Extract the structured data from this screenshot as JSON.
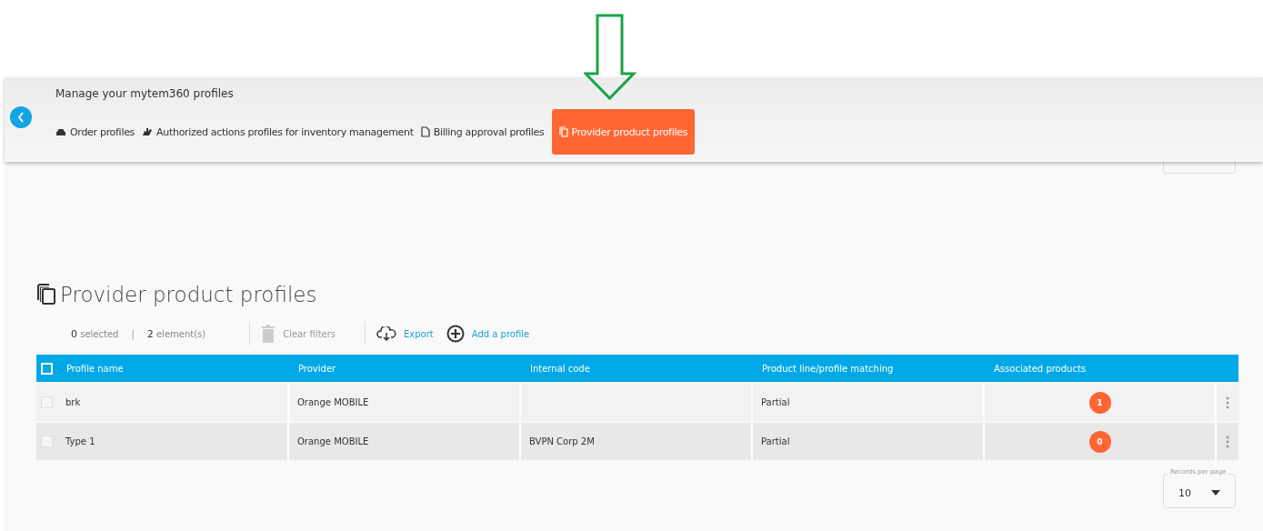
{
  "header": {
    "title": "Manage your mytem360 profiles",
    "tabs": [
      {
        "label": "Order profiles",
        "selected": false
      },
      {
        "label": "Authorized actions profiles for inventory management",
        "selected": false
      },
      {
        "label": "Billing approval profiles",
        "selected": false
      },
      {
        "label": "Provider product profiles",
        "selected": true
      }
    ]
  },
  "page_title": "Provider product profiles",
  "toolbar": {
    "selected_count": "0",
    "selected_label": "selected",
    "separator": "|",
    "element_count": "2",
    "element_label": "element(s)",
    "actions": [
      {
        "label": "Clear filters",
        "disabled": true
      },
      {
        "label": "Export",
        "disabled": false
      },
      {
        "label": "Add a profile",
        "disabled": false
      }
    ]
  },
  "table": {
    "all_checked": false,
    "columns": [
      "Profile name",
      "Provider",
      "Internal code",
      "Product line/profile matching",
      "Associated products"
    ],
    "rows": [
      {
        "checked": false,
        "cells": [
          "brk",
          "Orange MOBILE",
          "",
          "Partial"
        ],
        "count": "1"
      },
      {
        "checked": false,
        "cells": [
          "Type 1",
          "Orange MOBILE",
          "BVPN Corp 2M",
          "Partial"
        ],
        "count": "0"
      }
    ]
  },
  "pager": {
    "label": "Records per page",
    "value": "10"
  }
}
